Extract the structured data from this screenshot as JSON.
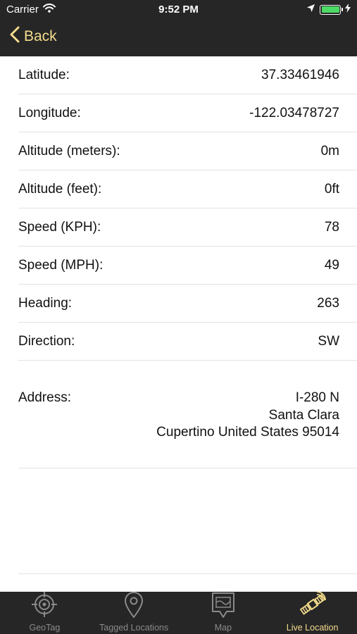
{
  "status_bar": {
    "carrier": "Carrier",
    "time": "9:52 PM"
  },
  "nav": {
    "back_label": "Back"
  },
  "rows": [
    {
      "label": "Latitude:",
      "value": "37.33461946"
    },
    {
      "label": "Longitude:",
      "value": "-122.03478727"
    },
    {
      "label": "Altitude (meters):",
      "value": "0m"
    },
    {
      "label": "Altitude (feet):",
      "value": "0ft"
    },
    {
      "label": "Speed (KPH):",
      "value": "78"
    },
    {
      "label": "Speed (MPH):",
      "value": "49"
    },
    {
      "label": "Heading:",
      "value": "263"
    },
    {
      "label": "Direction:",
      "value": "SW"
    }
  ],
  "address": {
    "label": "Address:",
    "lines": [
      "I-280 N",
      "Santa Clara",
      "Cupertino United States 95014"
    ]
  },
  "tabs": [
    {
      "label": "GeoTag",
      "icon": "crosshair-icon",
      "active": false
    },
    {
      "label": "Tagged Locations",
      "icon": "map-pin-icon",
      "active": false
    },
    {
      "label": "Map",
      "icon": "map-icon",
      "active": false
    },
    {
      "label": "Live Location",
      "icon": "satellite-icon",
      "active": true
    }
  ],
  "colors": {
    "accent": "#f4dc8c",
    "bar_background": "#262626",
    "battery": "#4cd964"
  }
}
